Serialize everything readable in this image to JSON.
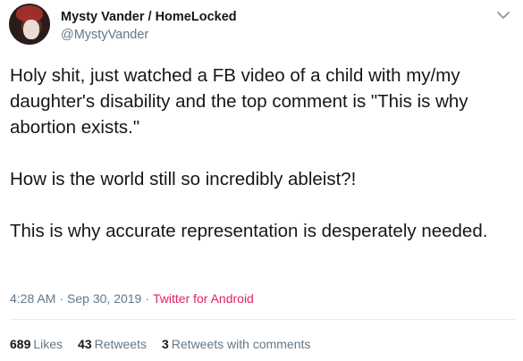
{
  "author": {
    "display_name": "Mysty Vander / HomeLocked",
    "handle": "@MystyVander"
  },
  "tweet": {
    "paragraphs": [
      "Holy shit, just watched a FB video of a child with my/my daughter's disability and the top comment is \"This is why abortion exists.\"",
      "How is the world still so incredibly ableist?!",
      "This is why accurate representation is desperately needed."
    ]
  },
  "meta": {
    "time": "4:28 AM",
    "separator1": "·",
    "date": "Sep 30, 2019",
    "separator2": "·",
    "source": "Twitter for Android"
  },
  "stats": {
    "likes_count": "689",
    "likes_label": "Likes",
    "retweets_count": "43",
    "retweets_label": "Retweets",
    "comments_count": "3",
    "comments_label": "Retweets with comments"
  },
  "icons": {
    "menu": "chevron-down-icon"
  },
  "colors": {
    "text": "#14171a",
    "secondary": "#657786",
    "source": "#e0245e",
    "divider": "#e6ecf0"
  }
}
